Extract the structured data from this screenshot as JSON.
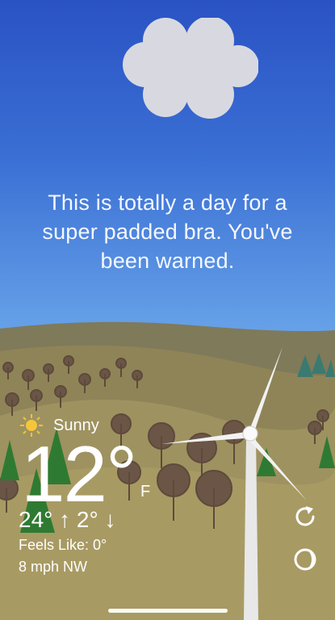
{
  "message": {
    "line1": "This is totally a day for a",
    "line2": "super padded bra. You've",
    "line3": "been warned."
  },
  "weather": {
    "icon": "sun-icon",
    "condition": "Sunny",
    "temperature": "12°",
    "unit": "F",
    "high": "24°",
    "high_arrow": "↑",
    "low": "2°",
    "low_arrow": "↓",
    "feels_like": "Feels Like: 0°",
    "wind": "8 mph NW"
  },
  "controls": {
    "refresh_icon": "refresh-icon",
    "theme_icon": "half-moon-icon"
  },
  "colors": {
    "sky_top": "#2a52c4",
    "sky_bottom": "#6aa6ea",
    "hill_back": "#8a7d58",
    "hill_front": "#a09360",
    "tree_green": "#2f7a32"
  }
}
